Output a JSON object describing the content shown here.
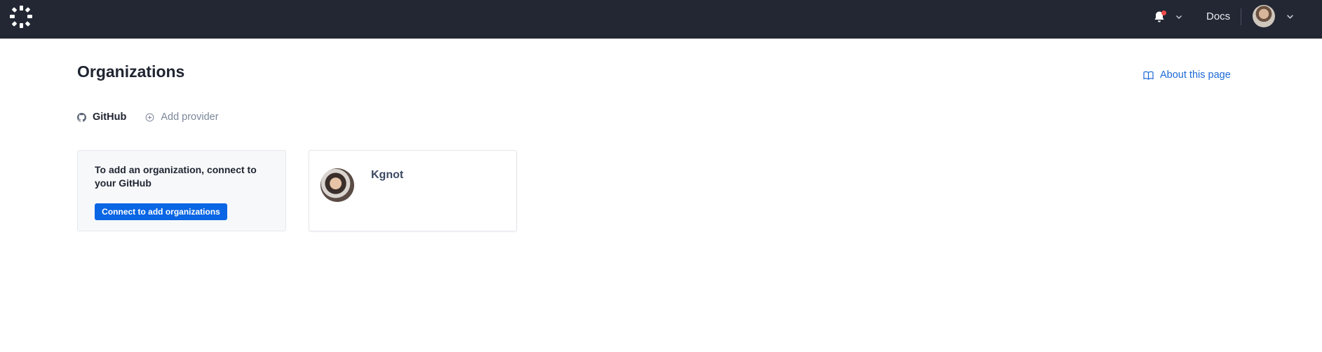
{
  "header": {
    "logo_icon": "brand-ring-logo-icon",
    "notifications_icon": "bell-icon",
    "has_unread": true,
    "docs_label": "Docs",
    "user_avatar": "user-avatar"
  },
  "page": {
    "title": "Organizations",
    "about_label": "About this page",
    "about_icon": "book-open-icon"
  },
  "providers": {
    "tabs": [
      {
        "label": "GitHub",
        "icon": "github-icon",
        "active": true
      },
      {
        "label": "Add provider",
        "icon": "plus-circle-icon",
        "active": false
      }
    ]
  },
  "connect_card": {
    "text": "To add an organization, connect to your GitHub",
    "button_label": "Connect to add organizations"
  },
  "org_card": {
    "name": "Kgnot"
  },
  "colors": {
    "topbar": "#222733",
    "accent": "#0a66e4",
    "link": "#1b68d6"
  }
}
